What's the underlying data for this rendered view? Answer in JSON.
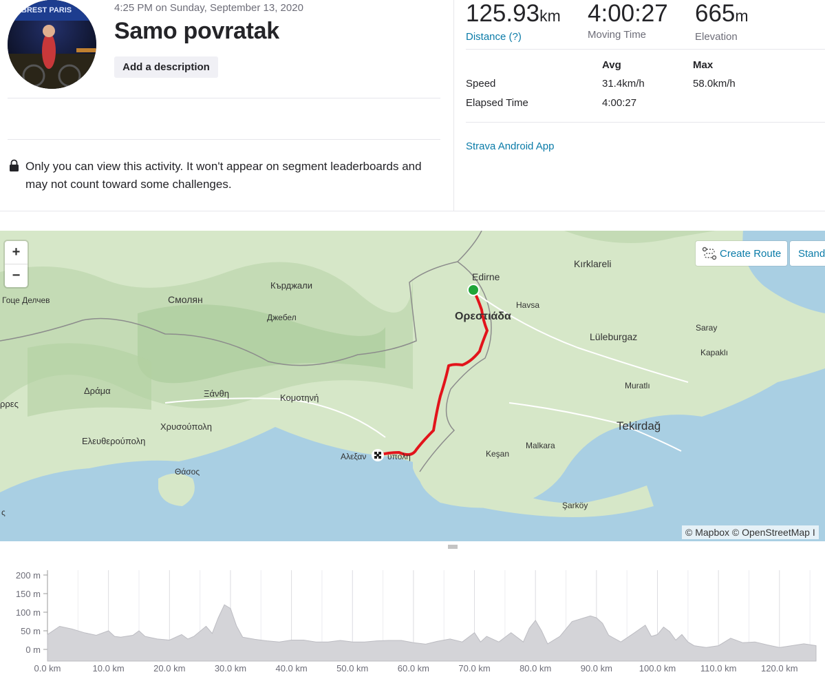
{
  "activity": {
    "timestamp": "4:25 PM on Sunday, September 13, 2020",
    "title": "Samo povratak",
    "add_description_label": "Add a description",
    "privacy_notice": "Only you can view this activity. It won't appear on segment leaderboards and may not count toward some challenges.",
    "avatar_text": "BREST PARIS"
  },
  "stats": {
    "distance_value": "125.93",
    "distance_unit": "km",
    "distance_label": "Distance (?)",
    "moving_time_value": "4:00:27",
    "moving_time_label": "Moving Time",
    "elevation_value": "665",
    "elevation_unit": "m",
    "elevation_label": "Elevation"
  },
  "details": {
    "col_avg": "Avg",
    "col_max": "Max",
    "rows": [
      {
        "label": "Speed",
        "avg": "31.4km/h",
        "max": "58.0km/h"
      },
      {
        "label": "Elapsed Time",
        "avg": "4:00:27",
        "max": ""
      }
    ],
    "device": "Strava Android App"
  },
  "map": {
    "zoom_in": "+",
    "zoom_out": "−",
    "create_route_label": "Create Route",
    "standard_label": "Stand",
    "attribution": "© Mapbox © OpenStreetMap I",
    "place_labels": {
      "gotse": "Гоце Делчев",
      "smolyan": "Смолян",
      "kardzhali": "Кърджали",
      "dzhebel": "Джебел",
      "edirne": "Edirne",
      "orestiada": "Ορεστιάδα",
      "havsa": "Havsa",
      "kirklareli": "Kırklareli",
      "saray": "Saray",
      "luleburgaz": "Lüleburgaz",
      "kapakli": "Kapaklı",
      "muratli": "Muratlı",
      "drama": "Δράμα",
      "xanthi": "Ξάνθη",
      "komotini": "Κομοτηνή",
      "serres": "ρρες",
      "chrysoupoli": "Χρυσούπολη",
      "eleftheroupoli": "Ελευθερούπολη",
      "thasos": "Θάσος",
      "alexandroupoli_a": "Αλεξαν",
      "alexandroupoli_b": "υπολη",
      "tekirdag": "Tekirdağ",
      "kesan": "Keşan",
      "malkara": "Malkara",
      "sarkoy": "Şarköy",
      "edge_s": "ς"
    },
    "colors": {
      "land": "#d6e7c8",
      "sea": "#a9cfe3",
      "route": "#e2141b",
      "start": "#1fa538"
    }
  },
  "elevation": {
    "y_ticks": [
      "200 m",
      "150 m",
      "100 m",
      "50 m",
      "0 m"
    ],
    "x_ticks": [
      "0.0 km",
      "10.0 km",
      "20.0 km",
      "30.0 km",
      "40.0 km",
      "50.0 km",
      "60.0 km",
      "70.0 km",
      "80.0 km",
      "90.0 km",
      "100.0 km",
      "110.0 km",
      "120.0 km"
    ]
  },
  "chart_data": {
    "type": "area",
    "title": "",
    "xlabel": "",
    "ylabel": "",
    "xlim": [
      0,
      126
    ],
    "ylim": [
      0,
      200
    ],
    "grid": true,
    "series": [
      {
        "x": [
          0,
          2,
          4,
          6,
          8,
          10,
          11,
          12,
          14,
          15,
          16,
          18,
          20,
          22,
          23,
          24,
          26,
          27,
          28,
          29,
          30,
          31,
          32,
          34,
          36,
          38,
          40,
          42,
          44,
          46,
          48,
          50,
          52,
          54,
          56,
          58,
          60,
          62,
          64,
          66,
          68,
          70,
          71,
          72,
          74,
          76,
          78,
          79,
          80,
          81,
          82,
          84,
          86,
          88,
          89,
          90,
          91,
          92,
          94,
          96,
          98,
          99,
          100,
          101,
          102,
          103,
          104,
          105,
          106,
          108,
          110,
          112,
          114,
          116,
          118,
          120,
          122,
          124,
          126
        ],
        "y": [
          40,
          62,
          55,
          45,
          38,
          50,
          35,
          33,
          38,
          50,
          35,
          28,
          25,
          40,
          28,
          35,
          62,
          43,
          85,
          120,
          110,
          63,
          33,
          27,
          23,
          20,
          25,
          25,
          20,
          20,
          24,
          20,
          20,
          23,
          24,
          24,
          18,
          14,
          22,
          28,
          20,
          45,
          20,
          35,
          20,
          45,
          20,
          57,
          78,
          50,
          15,
          35,
          75,
          85,
          90,
          85,
          70,
          38,
          20,
          42,
          65,
          35,
          40,
          60,
          48,
          25,
          40,
          20,
          10,
          5,
          10,
          30,
          18,
          20,
          12,
          5,
          10,
          15,
          10
        ]
      }
    ]
  }
}
